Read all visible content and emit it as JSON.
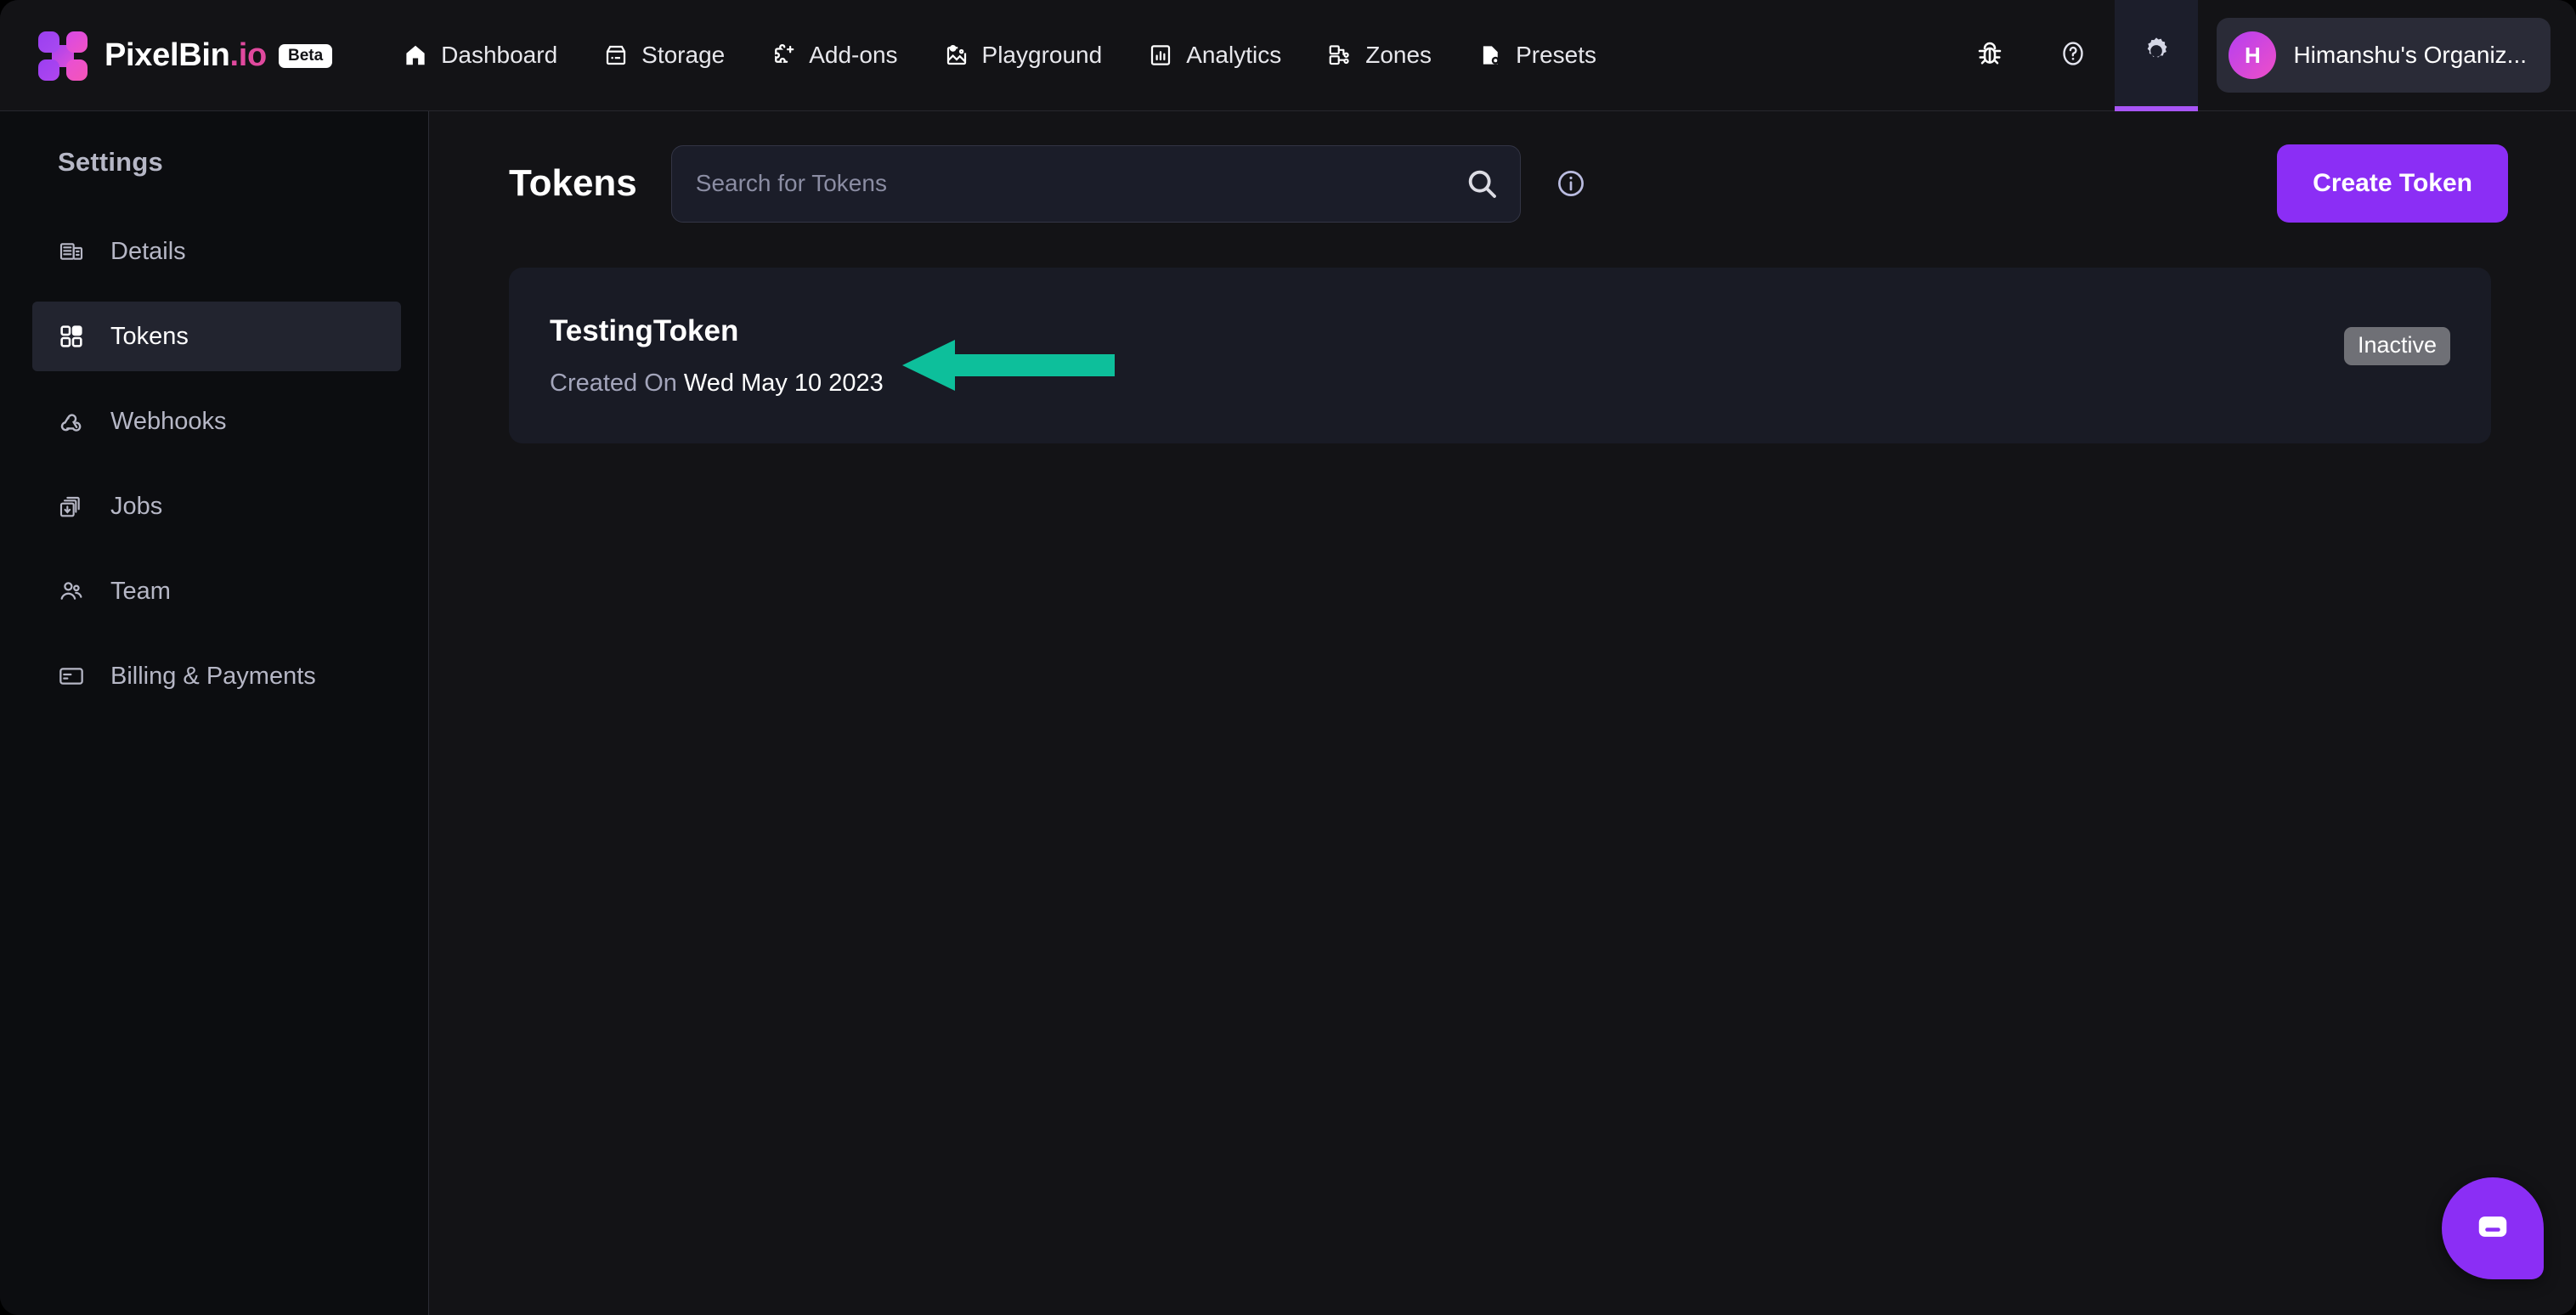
{
  "brand": {
    "name": "PixelBin",
    "suffix": ".io",
    "badge": "Beta",
    "logo_icon": "pixelbin-logo-icon",
    "accent_purple": "#8b2ef5",
    "accent_pink": "#ef4fc8"
  },
  "topnav": {
    "items": [
      {
        "label": "Dashboard",
        "icon": "home-icon"
      },
      {
        "label": "Storage",
        "icon": "storage-icon"
      },
      {
        "label": "Add-ons",
        "icon": "puzzle-plus-icon"
      },
      {
        "label": "Playground",
        "icon": "image-gear-icon"
      },
      {
        "label": "Analytics",
        "icon": "bar-chart-icon"
      },
      {
        "label": "Zones",
        "icon": "zones-icon"
      },
      {
        "label": "Presets",
        "icon": "file-gear-icon"
      }
    ],
    "actions": [
      {
        "name": "report-bug",
        "icon": "bug-icon",
        "active": false
      },
      {
        "name": "help",
        "icon": "question-circle-icon",
        "active": false
      },
      {
        "name": "settings",
        "icon": "gear-icon",
        "active": true
      }
    ],
    "organization": {
      "avatar_initial": "H",
      "name": "Himanshu's Organiz..."
    }
  },
  "sidebar": {
    "title": "Settings",
    "items": [
      {
        "label": "Details",
        "icon": "building-icon",
        "active": false
      },
      {
        "label": "Tokens",
        "icon": "grid-blocks-icon",
        "active": true
      },
      {
        "label": "Webhooks",
        "icon": "webhook-icon",
        "active": false
      },
      {
        "label": "Jobs",
        "icon": "jobs-stack-icon",
        "active": false
      },
      {
        "label": "Team",
        "icon": "people-icon",
        "active": false
      },
      {
        "label": "Billing & Payments",
        "icon": "credit-card-icon",
        "active": false
      }
    ]
  },
  "main": {
    "page_title": "Tokens",
    "search": {
      "value": "",
      "placeholder": "Search for Tokens",
      "button_icon": "search-icon"
    },
    "info_icon": "info-circle-icon",
    "create_button": "Create Token",
    "tokens": [
      {
        "name": "TestingToken",
        "created_label": "Created On",
        "created_value": "Wed May 10 2023",
        "status": "Inactive"
      }
    ]
  },
  "annotation": {
    "type": "arrow",
    "direction": "left",
    "color": "#0dbf9b",
    "points_to": "TestingToken"
  },
  "chat_widget": {
    "icon": "chat-bubble-icon",
    "color": "#8b2ef5"
  }
}
